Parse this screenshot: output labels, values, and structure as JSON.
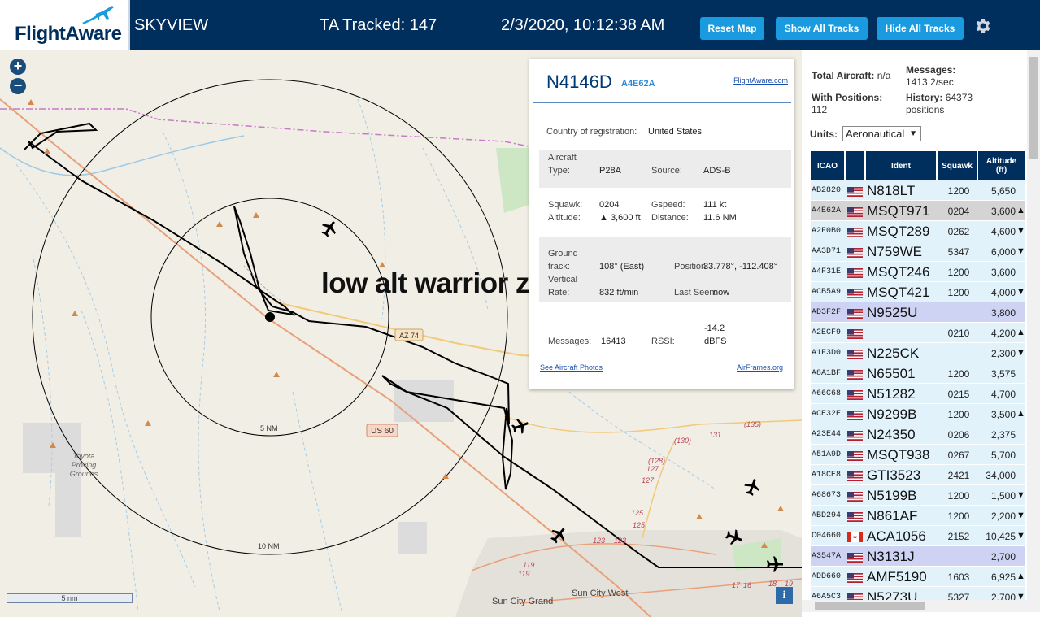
{
  "header": {
    "logo_text": "FlightAware",
    "title": "SKYVIEW",
    "tracked": "TA Tracked: 147",
    "datetime": "2/3/2020, 10:12:38 AM",
    "buttons": {
      "reset": "Reset Map",
      "show": "Show All Tracks",
      "hide": "Hide All Tracks"
    },
    "accent_color": "#1a9be0",
    "bar_color": "#002f5d"
  },
  "map": {
    "annotation": "low alt warrior zone",
    "ring_labels": {
      "inner": "5 NM",
      "outer": "10 NM"
    },
    "scale_label": "5 nm",
    "place_labels": {
      "proving_grounds_1": "Toyota",
      "proving_grounds_2": "Proving",
      "proving_grounds_3": "Grounds",
      "sun_city_grand": "Sun City Grand",
      "sun_city_west": "Sun City West"
    },
    "road_labels": {
      "az74": "AZ 74",
      "us60": "US 60",
      "r135": "(135)",
      "r130": "(130)",
      "r131": "131",
      "r128": "(128)",
      "r127a": "127",
      "r127b": "127",
      "r125a": "125",
      "r125b": "125",
      "r123a": "123",
      "r123b": "123",
      "r119a": "119",
      "r119b": "119",
      "r17": "17",
      "r16": "16",
      "r18": "18",
      "r19": "19"
    },
    "zoom_in": "+",
    "zoom_out": "−",
    "info": "i"
  },
  "popup": {
    "ident": "N4146D",
    "icao": "A4E62A",
    "flightaware_link": "FlightAware.com",
    "country_label": "Country of registration:",
    "country": "United States",
    "aircraft_type_label_1": "Aircraft",
    "aircraft_type_label_2": "Type:",
    "aircraft_type": "P28A",
    "source_label": "Source:",
    "source": "ADS-B",
    "squawk_label": "Squawk:",
    "squawk": "0204",
    "gspeed_label": "Gspeed:",
    "gspeed": "111 kt",
    "altitude_label": "Altitude:",
    "altitude": "▲ 3,600 ft",
    "distance_label": "Distance:",
    "distance": "11.6 NM",
    "ground_track_label_1": "Ground",
    "ground_track_label_2": "track:",
    "ground_track": "108° (East)",
    "position_label": "Position:",
    "position": "33.778°, -112.408°",
    "vertical_label_1": "Vertical",
    "vertical_label_2": "Rate:",
    "vertical_rate": "832 ft/min",
    "last_seen_label": "Last Seen:",
    "last_seen": "now",
    "messages_label": "Messages:",
    "messages": "16413",
    "rssi_label": "RSSI:",
    "rssi_1": "-14.2",
    "rssi_2": "dBFS",
    "photos_link": "See Aircraft Photos",
    "airframes_link": "AirFrames.org"
  },
  "sidebar": {
    "total_aircraft_label": "Total Aircraft:",
    "total_aircraft": "n/a",
    "with_positions_label": "With Positions:",
    "with_positions": "112",
    "messages_label": "Messages:",
    "messages": "1413.2/sec",
    "history_label": "History:",
    "history_count": "64373",
    "history_unit": "positions",
    "units_label": "Units:",
    "units_value": "Aeronautical",
    "columns": {
      "icao": "ICAO",
      "ident": "Ident",
      "squawk": "Squawk",
      "altitude_1": "Altitude",
      "altitude_2": "(ft)"
    }
  },
  "aircraft": [
    {
      "icao": "AB2820",
      "flag": "us",
      "ident": "N818LT",
      "squawk": "1200",
      "altitude": "5,650",
      "dir": "",
      "state": ""
    },
    {
      "icao": "A4E62A",
      "flag": "us",
      "ident": "MSQT971",
      "squawk": "0204",
      "altitude": "3,600",
      "dir": "▲",
      "state": "sel"
    },
    {
      "icao": "A2F0B0",
      "flag": "us",
      "ident": "MSQT289",
      "squawk": "0262",
      "altitude": "4,600",
      "dir": "▼",
      "state": ""
    },
    {
      "icao": "AA3D71",
      "flag": "us",
      "ident": "N759WE",
      "squawk": "5347",
      "altitude": "6,000",
      "dir": "▼",
      "state": ""
    },
    {
      "icao": "A4F31E",
      "flag": "us",
      "ident": "MSQT246",
      "squawk": "1200",
      "altitude": "3,600",
      "dir": "",
      "state": ""
    },
    {
      "icao": "ACB5A9",
      "flag": "us",
      "ident": "MSQT421",
      "squawk": "1200",
      "altitude": "4,000",
      "dir": "▼",
      "state": ""
    },
    {
      "icao": "AD3F2F",
      "flag": "us",
      "ident": "N9525U",
      "squawk": "",
      "altitude": "3,800",
      "dir": "",
      "state": "hl"
    },
    {
      "icao": "A2ECF9",
      "flag": "us",
      "ident": "",
      "squawk": "0210",
      "altitude": "4,200",
      "dir": "▲",
      "state": ""
    },
    {
      "icao": "A1F3D0",
      "flag": "us",
      "ident": "N225CK",
      "squawk": "",
      "altitude": "2,300",
      "dir": "▼",
      "state": ""
    },
    {
      "icao": "A8A1BF",
      "flag": "us",
      "ident": "N65501",
      "squawk": "1200",
      "altitude": "3,575",
      "dir": "",
      "state": ""
    },
    {
      "icao": "A66C68",
      "flag": "us",
      "ident": "N51282",
      "squawk": "0215",
      "altitude": "4,700",
      "dir": "",
      "state": ""
    },
    {
      "icao": "ACE32E",
      "flag": "us",
      "ident": "N9299B",
      "squawk": "1200",
      "altitude": "3,500",
      "dir": "▲",
      "state": ""
    },
    {
      "icao": "A23E44",
      "flag": "us",
      "ident": "N24350",
      "squawk": "0206",
      "altitude": "2,375",
      "dir": "",
      "state": ""
    },
    {
      "icao": "A51A9D",
      "flag": "us",
      "ident": "MSQT938",
      "squawk": "0267",
      "altitude": "5,700",
      "dir": "",
      "state": ""
    },
    {
      "icao": "A18CE8",
      "flag": "us",
      "ident": "GTI3523",
      "squawk": "2421",
      "altitude": "34,000",
      "dir": "",
      "state": ""
    },
    {
      "icao": "A68673",
      "flag": "us",
      "ident": "N5199B",
      "squawk": "1200",
      "altitude": "1,500",
      "dir": "▼",
      "state": ""
    },
    {
      "icao": "ABD294",
      "flag": "us",
      "ident": "N861AF",
      "squawk": "1200",
      "altitude": "2,200",
      "dir": "▼",
      "state": ""
    },
    {
      "icao": "C04660",
      "flag": "ca",
      "ident": "ACA1056",
      "squawk": "2152",
      "altitude": "10,425",
      "dir": "▼",
      "state": ""
    },
    {
      "icao": "A3547A",
      "flag": "us",
      "ident": "N3131J",
      "squawk": "",
      "altitude": "2,700",
      "dir": "",
      "state": "hl"
    },
    {
      "icao": "ADD660",
      "flag": "us",
      "ident": "AMF5190",
      "squawk": "1603",
      "altitude": "6,925",
      "dir": "▲",
      "state": ""
    },
    {
      "icao": "A6A5C3",
      "flag": "us",
      "ident": "N5273U",
      "squawk": "5327",
      "altitude": "2,700",
      "dir": "▼",
      "state": ""
    }
  ]
}
